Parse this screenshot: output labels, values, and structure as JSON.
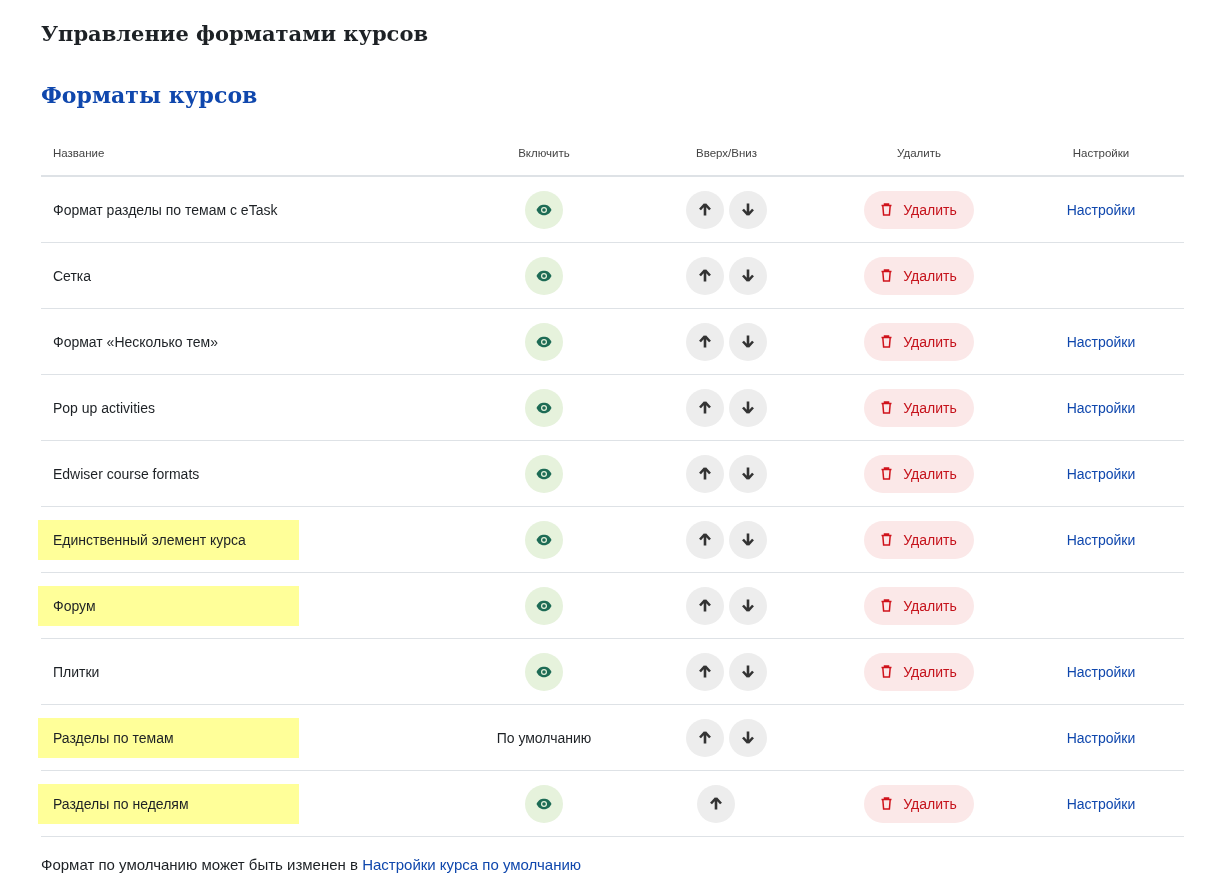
{
  "page_title": "Управление форматами курсов",
  "section_title": "Форматы курсов",
  "table": {
    "columns": [
      "Название",
      "Включить",
      "Вверх/Вниз",
      "Удалить",
      "Настройки"
    ],
    "rows": [
      {
        "name": "Формат разделы по темам с eTask",
        "highlighted": false,
        "enable": {
          "kind": "eye"
        },
        "move_up": true,
        "move_down": true,
        "delete": "Удалить",
        "settings": "Настройки"
      },
      {
        "name": "Сетка",
        "highlighted": false,
        "enable": {
          "kind": "eye"
        },
        "move_up": true,
        "move_down": true,
        "delete": "Удалить",
        "settings": null
      },
      {
        "name": "Формат «Несколько тем»",
        "highlighted": false,
        "enable": {
          "kind": "eye"
        },
        "move_up": true,
        "move_down": true,
        "delete": "Удалить",
        "settings": "Настройки"
      },
      {
        "name": "Pop up activities",
        "highlighted": false,
        "enable": {
          "kind": "eye"
        },
        "move_up": true,
        "move_down": true,
        "delete": "Удалить",
        "settings": "Настройки"
      },
      {
        "name": "Edwiser course formats",
        "highlighted": false,
        "enable": {
          "kind": "eye"
        },
        "move_up": true,
        "move_down": true,
        "delete": "Удалить",
        "settings": "Настройки"
      },
      {
        "name": "Единственный элемент курса",
        "highlighted": true,
        "enable": {
          "kind": "eye"
        },
        "move_up": true,
        "move_down": true,
        "delete": "Удалить",
        "settings": "Настройки"
      },
      {
        "name": "Форум",
        "highlighted": true,
        "enable": {
          "kind": "eye"
        },
        "move_up": true,
        "move_down": true,
        "delete": "Удалить",
        "settings": null
      },
      {
        "name": "Плитки",
        "highlighted": false,
        "enable": {
          "kind": "eye"
        },
        "move_up": true,
        "move_down": true,
        "delete": "Удалить",
        "settings": "Настройки"
      },
      {
        "name": "Разделы по темам",
        "highlighted": true,
        "enable": {
          "kind": "text",
          "text": "По умолчанию"
        },
        "move_up": true,
        "move_down": true,
        "delete": null,
        "settings": "Настройки"
      },
      {
        "name": "Разделы по неделям",
        "highlighted": true,
        "enable": {
          "kind": "eye"
        },
        "move_up": true,
        "move_down": false,
        "delete": "Удалить",
        "settings": "Настройки"
      }
    ]
  },
  "footer": {
    "text": "Формат по умолчанию может быть изменен в",
    "link": "Настройки курса по умолчанию"
  }
}
